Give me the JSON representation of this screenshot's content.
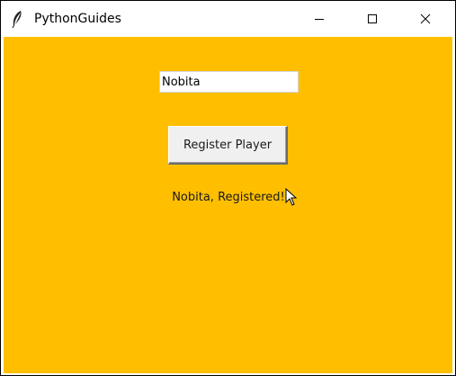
{
  "window": {
    "title": "PythonGuides",
    "app_icon": "feather-icon",
    "controls": [
      "minimize-icon",
      "maximize-icon",
      "close-icon"
    ],
    "background_color": "#ffbf00"
  },
  "form": {
    "name_value": "Nobita",
    "register_button_label": "Register Player",
    "result_text": "Nobita, Registered!"
  }
}
